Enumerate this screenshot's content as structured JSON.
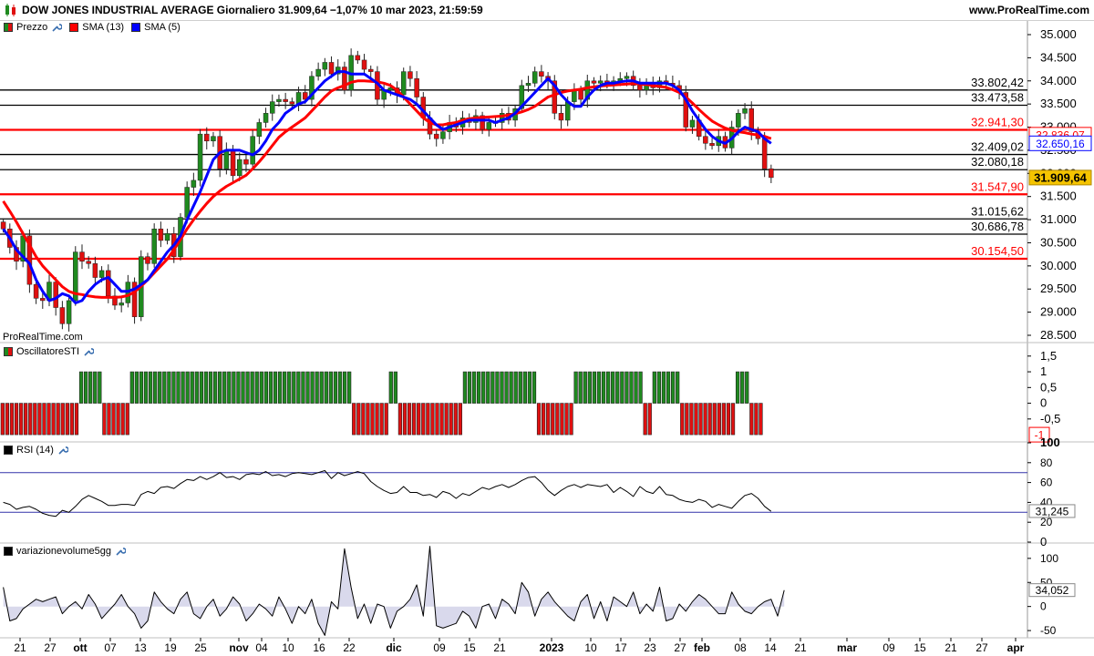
{
  "header": {
    "title": "DOW JONES INDUSTRIAL AVERAGE Giornaliero 31.909,64 −1,07% 10 mar 2023, 21:59:59",
    "site": "www.ProRealTime.com"
  },
  "legend_price": {
    "prezzo": "Prezzo",
    "sma13": "SMA (13)",
    "sma5": "SMA (5)"
  },
  "brand_label": "ProRealTime.com",
  "panels": {
    "sti_label": "OscillatoreSTI",
    "rsi_label": "RSI (14)",
    "vol_label": "variazionevolume5gg"
  },
  "colors": {
    "up": "#1f8a1f",
    "down": "#e01010",
    "sma13": "#ff0000",
    "sma5": "#0000ff",
    "area_fill": "#d9d9ec",
    "current_price": "#f5c400"
  },
  "chart_data": [
    {
      "type": "candlestick",
      "panel": "price",
      "ylim": [
        28500,
        35000
      ],
      "yticks": [
        "35.000",
        "34.500",
        "34.000",
        "33.500",
        "33.000",
        "32.500",
        "32.000",
        "31.500",
        "31.000",
        "30.500",
        "30.000",
        "29.500",
        "29.000",
        "28.500"
      ],
      "x_labels": [
        "21",
        "27",
        "ott",
        "07",
        "13",
        "19",
        "25",
        "nov",
        "04",
        "10",
        "16",
        "22",
        "dic",
        "09",
        "15",
        "21",
        "2023",
        "10",
        "17",
        "23",
        "27",
        "feb",
        "08",
        "14",
        "21",
        "mar",
        "09",
        "15",
        "21",
        "27",
        "apr"
      ],
      "series": [
        {
          "name": "Prezzo",
          "closes": [
            30800,
            30400,
            30100,
            30650,
            29600,
            29300,
            29250,
            29650,
            29100,
            28750,
            29250,
            30300,
            30100,
            30050,
            29750,
            29900,
            29350,
            29150,
            29200,
            29650,
            28900,
            30200,
            30050,
            30800,
            30550,
            30700,
            30200,
            31050,
            31700,
            31850,
            32850,
            32700,
            32800,
            32100,
            32500,
            31950,
            32300,
            32200,
            32800,
            33100,
            33300,
            33550,
            33600,
            33550,
            33500,
            33750,
            33600,
            34100,
            34250,
            34400,
            34150,
            34300,
            33800,
            34550,
            34450,
            34250,
            34200,
            33600,
            33800,
            33850,
            33700,
            34200,
            34050,
            33650,
            33200,
            32850,
            32750,
            32900,
            33100,
            33000,
            33200,
            33100,
            33250,
            32950,
            33100,
            33100,
            33300,
            33150,
            33400,
            33900,
            33950,
            34200,
            34100,
            34000,
            33300,
            33150,
            33550,
            33800,
            33600,
            34000,
            33950,
            34000,
            33950,
            34000,
            34050,
            34100,
            33900,
            33800,
            33950,
            33850,
            34000,
            33950,
            33900,
            33750,
            33000,
            33150,
            32800,
            32650,
            32600,
            32800,
            32550,
            33000,
            33300,
            33400,
            32900,
            32750,
            32100,
            31910
          ]
        },
        {
          "name": "SMA (13)",
          "values": [
            31400,
            31180,
            30950,
            30700,
            30450,
            30200,
            30000,
            29850,
            29700,
            29550,
            29450,
            29400,
            29380,
            29350,
            29330,
            29320,
            29320,
            29320,
            29330,
            29360,
            29440,
            29560,
            29700,
            29850,
            30000,
            30150,
            30350,
            30570,
            30800,
            31000,
            31180,
            31350,
            31500,
            31620,
            31720,
            31800,
            31880,
            31960,
            32100,
            32250,
            32420,
            32600,
            32780,
            32900,
            33000,
            33100,
            33200,
            33350,
            33500,
            33650,
            33780,
            33850,
            33900,
            33970,
            34000,
            34000,
            33990,
            33980,
            33950,
            33900,
            33800,
            33650,
            33500,
            33350,
            33200,
            33100,
            33050,
            33050,
            33080,
            33100,
            33150,
            33180,
            33200,
            33210,
            33220,
            33230,
            33240,
            33260,
            33290,
            33330,
            33380,
            33450,
            33550,
            33650,
            33700,
            33750,
            33780,
            33800,
            33820,
            33850,
            33870,
            33890,
            33900,
            33910,
            33920,
            33930,
            33940,
            33930,
            33920,
            33900,
            33880,
            33860,
            33810,
            33750,
            33650,
            33520,
            33380,
            33250,
            33130,
            33050,
            32980,
            32930,
            32900,
            32880,
            32850,
            32830,
            32800,
            32750
          ]
        },
        {
          "name": "SMA (5)",
          "values": [
            30800,
            30600,
            30350,
            30200,
            30050,
            29700,
            29450,
            29250,
            29300,
            29400,
            29350,
            29200,
            29250,
            29450,
            29600,
            29700,
            29750,
            29600,
            29450,
            29450,
            29500,
            29600,
            29700,
            29900,
            30100,
            30300,
            30450,
            30650,
            31000,
            31300,
            31600,
            31950,
            32300,
            32450,
            32500,
            32500,
            32500,
            32450,
            32400,
            32500,
            32700,
            32950,
            33100,
            33300,
            33400,
            33500,
            33550,
            33700,
            33850,
            34000,
            34100,
            34200,
            34200,
            34150,
            34150,
            34150,
            34050,
            33950,
            33800,
            33750,
            33700,
            33650,
            33600,
            33500,
            33350,
            33200,
            33050,
            32950,
            33000,
            33050,
            33100,
            33150,
            33150,
            33150,
            33150,
            33100,
            33150,
            33200,
            33300,
            33450,
            33600,
            33750,
            33900,
            34050,
            33900,
            33700,
            33550,
            33450,
            33450,
            33650,
            33800,
            33900,
            33950,
            33950,
            33980,
            34000,
            34000,
            33950,
            33950,
            33950,
            33950,
            33950,
            33900,
            33800,
            33600,
            33350,
            33150,
            32950,
            32800,
            32700,
            32650,
            32750,
            32900,
            33000,
            32950,
            32900,
            32750,
            32650
          ]
        }
      ],
      "levels": [
        {
          "value": 33802.42,
          "label": "33.802,42",
          "color": "black"
        },
        {
          "value": 33473.58,
          "label": "33.473,58",
          "color": "black"
        },
        {
          "value": 32941.3,
          "label": "32.941,30",
          "color": "red"
        },
        {
          "value": 32409.02,
          "label": "32.409,02",
          "color": "black"
        },
        {
          "value": 32080.18,
          "label": "32.080,18",
          "color": "black"
        },
        {
          "value": 31547.9,
          "label": "31.547,90",
          "color": "red"
        },
        {
          "value": 31015.62,
          "label": "31.015,62",
          "color": "black"
        },
        {
          "value": 30686.78,
          "label": "30.686,78",
          "color": "black"
        },
        {
          "value": 30154.5,
          "label": "30.154,50",
          "color": "red"
        }
      ],
      "value_boxes": [
        {
          "value": 32836.07,
          "label": "32.836,07",
          "color": "red"
        },
        {
          "value": 32650.16,
          "label": "32.650,16",
          "color": "blue"
        },
        {
          "value": 31909.64,
          "label": "31.909,64",
          "color": "current"
        }
      ]
    },
    {
      "type": "bar",
      "panel": "sti",
      "title": "OscillatoreSTI",
      "ylim": [
        -1.2,
        1.9
      ],
      "yticks": [
        "1,5",
        "1",
        "0,5",
        "0",
        "-0,5"
      ],
      "last_label": "-1",
      "values": [
        -1,
        -1,
        -1,
        -1,
        -1,
        -1,
        -1,
        -1,
        -1,
        -1,
        -1,
        -1,
        -1,
        -1,
        -1,
        -1,
        -1,
        1,
        1,
        1,
        1,
        1,
        -1,
        -1,
        -1,
        -1,
        -1,
        -1,
        1,
        1,
        1,
        1,
        1,
        1,
        1,
        1,
        1,
        1,
        1,
        1,
        1,
        1,
        1,
        1,
        1,
        1,
        1,
        1,
        1,
        1,
        1,
        1,
        1,
        1,
        1,
        1,
        1,
        1,
        1,
        1,
        1,
        1,
        1,
        1,
        1,
        1,
        1,
        1,
        1,
        1,
        1,
        1,
        1,
        1,
        1,
        1,
        -1,
        -1,
        -1,
        -1,
        -1,
        -1,
        -1,
        -1,
        1,
        1,
        -1,
        -1,
        -1,
        -1,
        -1,
        -1,
        -1,
        -1,
        -1,
        -1,
        -1,
        -1,
        -1,
        -1,
        1,
        1,
        1,
        1,
        1,
        1,
        1,
        1,
        1,
        1,
        1,
        1,
        1,
        1,
        1,
        1,
        -1,
        -1,
        -1,
        -1,
        -1,
        -1,
        -1,
        -1,
        1,
        1,
        1,
        1,
        1,
        1,
        1,
        1,
        1,
        1,
        1,
        1,
        1,
        1,
        1,
        -1,
        -1,
        1,
        1,
        1,
        1,
        1,
        1,
        -1,
        -1,
        -1,
        -1,
        -1,
        -1,
        -1,
        -1,
        -1,
        -1,
        -1,
        -1,
        1,
        1,
        1,
        -1,
        -1,
        -1
      ]
    },
    {
      "type": "line",
      "panel": "rsi",
      "title": "RSI (14)",
      "ylim": [
        0,
        100
      ],
      "yticks": [
        "100",
        "80",
        "60",
        "40",
        "20",
        "0"
      ],
      "bands": [
        30,
        70
      ],
      "last_label": "31,245",
      "values": [
        40,
        38,
        33,
        35,
        36,
        33,
        29,
        27,
        26,
        32,
        30,
        36,
        43,
        47,
        44,
        41,
        37,
        37,
        38,
        38,
        37,
        48,
        51,
        49,
        55,
        56,
        54,
        59,
        63,
        62,
        66,
        63,
        66,
        70,
        65,
        66,
        63,
        68,
        69,
        68,
        71,
        67,
        68,
        66,
        69,
        70,
        69,
        68,
        70,
        72,
        64,
        70,
        67,
        69,
        71,
        69,
        61,
        56,
        52,
        49,
        50,
        56,
        50,
        50,
        47,
        48,
        45,
        51,
        49,
        44,
        49,
        47,
        51,
        55,
        53,
        56,
        58,
        55,
        58,
        62,
        65,
        66,
        60,
        52,
        47,
        52,
        56,
        58,
        55,
        58,
        57,
        56,
        58,
        50,
        55,
        51,
        46,
        56,
        51,
        49,
        56,
        48,
        47,
        43,
        41,
        40,
        43,
        41,
        35,
        38,
        36,
        34,
        41,
        47,
        49,
        44,
        36,
        31
      ]
    },
    {
      "type": "area",
      "panel": "vol",
      "title": "variazionevolume5gg",
      "ylim": [
        -65,
        130
      ],
      "yticks": [
        "100",
        "50",
        "0",
        "-50"
      ],
      "last_label": "34,052",
      "values": [
        40,
        -30,
        -25,
        -5,
        5,
        15,
        10,
        15,
        20,
        -15,
        0,
        10,
        -5,
        25,
        5,
        -25,
        -10,
        5,
        25,
        0,
        -15,
        -45,
        -30,
        30,
        10,
        -5,
        -15,
        15,
        30,
        -15,
        -25,
        0,
        15,
        -20,
        -5,
        20,
        5,
        -30,
        -15,
        5,
        -5,
        -20,
        20,
        -5,
        -35,
        0,
        -15,
        15,
        -35,
        -60,
        10,
        -5,
        120,
        40,
        -25,
        5,
        -35,
        5,
        0,
        -45,
        -10,
        0,
        15,
        45,
        -20,
        125,
        -40,
        -45,
        -40,
        -35,
        -10,
        -20,
        -45,
        0,
        5,
        -25,
        15,
        5,
        -15,
        50,
        30,
        -20,
        15,
        30,
        10,
        -5,
        -20,
        -30,
        10,
        25,
        -25,
        10,
        -30,
        20,
        10,
        0,
        30,
        -15,
        5,
        -10,
        40,
        -30,
        -25,
        5,
        -10,
        10,
        25,
        15,
        0,
        -15,
        -15,
        30,
        5,
        -10,
        -15,
        0,
        10,
        15,
        -20,
        34
      ]
    }
  ]
}
